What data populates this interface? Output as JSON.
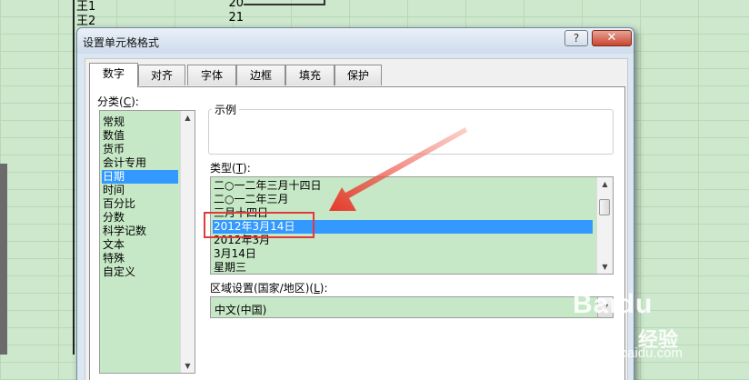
{
  "sheet": {
    "rows": [
      {
        "name": "王1",
        "value": "20"
      },
      {
        "name": "王2",
        "value": "21"
      }
    ]
  },
  "dialog": {
    "title": "设置单元格格式",
    "help_label": "?",
    "close_label": "✕",
    "tabs": [
      {
        "label": "数字",
        "active": true
      },
      {
        "label": "对齐"
      },
      {
        "label": "字体"
      },
      {
        "label": "边框"
      },
      {
        "label": "填充"
      },
      {
        "label": "保护"
      }
    ]
  },
  "category": {
    "label": "分类(",
    "hotkey": "C",
    "label_end": "):",
    "items": [
      "常规",
      "数值",
      "货币",
      "会计专用",
      "日期",
      "时间",
      "百分比",
      "分数",
      "科学记数",
      "文本",
      "特殊",
      "自定义"
    ],
    "selected": "日期"
  },
  "sample": {
    "label": "示例",
    "value": ""
  },
  "type": {
    "label": "类型(",
    "hotkey": "T",
    "label_end": "):",
    "items": [
      "二○一二年三月十四日",
      "二○一二年三月",
      "三月十四日",
      "2012年3月14日",
      "2012年3月",
      "3月14日",
      "星期三"
    ],
    "selected": "2012年3月14日"
  },
  "locale": {
    "label": "区域设置(国家/地区)(",
    "hotkey": "L",
    "label_end": "):",
    "value": "中文(中国)"
  },
  "annotation": {
    "color": "#e03a3a"
  },
  "watermark": {
    "brand": "Baidu",
    "sub": "经验",
    "url": "jingyan.baidu.com"
  }
}
